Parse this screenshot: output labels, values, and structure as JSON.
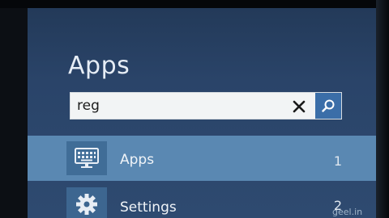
{
  "panel": {
    "title": "Apps"
  },
  "search": {
    "value": "reg"
  },
  "results": [
    {
      "label": "Apps",
      "count": "1",
      "icon": "keyboard-monitor-icon",
      "selected": true
    },
    {
      "label": "Settings",
      "count": "2",
      "icon": "gear-icon",
      "selected": false
    }
  ],
  "watermark": "geel.in",
  "colors": {
    "panel_bg": "#2a4469",
    "selected_row": "#5a88b2",
    "search_button": "#3b6ea8"
  }
}
